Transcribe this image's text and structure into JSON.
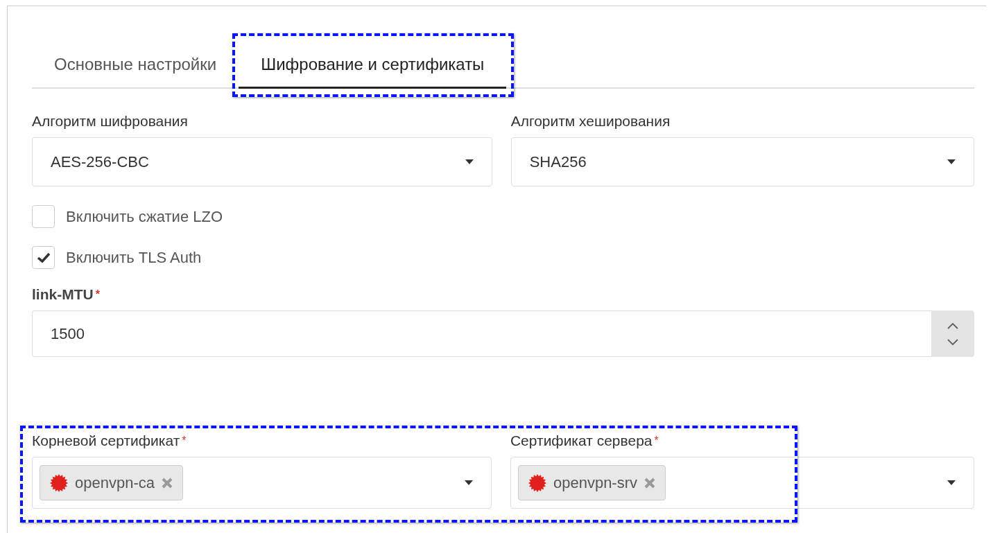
{
  "tabs": [
    {
      "label": "Основные настройки",
      "selected": false,
      "highlighted": false
    },
    {
      "label": "Шифрование и сертификаты",
      "selected": true,
      "highlighted": true
    }
  ],
  "selects": [
    {
      "label": "Алгоритм шифрования",
      "value": "AES-256-CBC"
    },
    {
      "label": "Алгоритм хеширования",
      "value": "SHA256"
    }
  ],
  "checkboxes": [
    {
      "label": "Включить сжатие LZO",
      "checked": false
    },
    {
      "label": "Включить TLS Auth",
      "checked": true
    }
  ],
  "mtu": {
    "label": "link-MTU",
    "required_mark": "*",
    "value": "1500"
  },
  "certificates": {
    "highlighted": true,
    "fields": [
      {
        "label": "Корневой сертификат",
        "required_mark": "*",
        "tags": [
          "openvpn-ca"
        ]
      },
      {
        "label": "Сертификат сервера",
        "required_mark": "*",
        "tags": [
          "openvpn-srv"
        ]
      }
    ]
  }
}
